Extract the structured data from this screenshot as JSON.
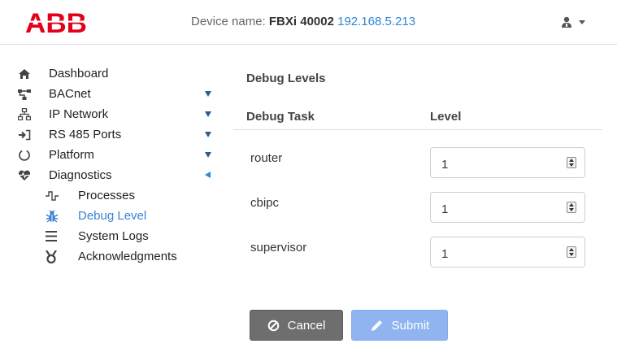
{
  "header": {
    "logo_text": "ABB",
    "device_label": "Device name:",
    "device_name": "FBXi 40002",
    "device_ip": "192.168.5.213",
    "user_icon": "user-icon"
  },
  "sidebar": {
    "items": [
      {
        "label": "Dashboard",
        "icon": "home-icon"
      },
      {
        "label": "BACnet",
        "icon": "network-tree-icon"
      },
      {
        "label": "IP Network",
        "icon": "sitemap-icon"
      },
      {
        "label": "RS 485 Ports",
        "icon": "sign-in-icon"
      },
      {
        "label": "Platform",
        "icon": "circle-notch-icon"
      },
      {
        "label": "Diagnostics",
        "icon": "heartbeat-icon"
      }
    ],
    "sub_items": [
      {
        "label": "Processes",
        "icon": "pulse-icon"
      },
      {
        "label": "Debug Level",
        "icon": "bug-icon"
      },
      {
        "label": "System Logs",
        "icon": "list-icon"
      },
      {
        "label": "Acknowledgments",
        "icon": "award-icon"
      }
    ]
  },
  "main": {
    "title": "Debug Levels",
    "columns": {
      "task": "Debug Task",
      "level": "Level"
    },
    "rows": [
      {
        "task": "router",
        "level": "1"
      },
      {
        "task": "cbipc",
        "level": "1"
      },
      {
        "task": "supervisor",
        "level": "1"
      }
    ],
    "cancel_label": "Cancel",
    "submit_label": "Submit"
  },
  "colors": {
    "brand": "#e2001a",
    "accent": "#2f86d6",
    "active_item": "#3b82d6",
    "cancel_bg": "#6e6e6e",
    "submit_bg": "#8fb4ef"
  }
}
